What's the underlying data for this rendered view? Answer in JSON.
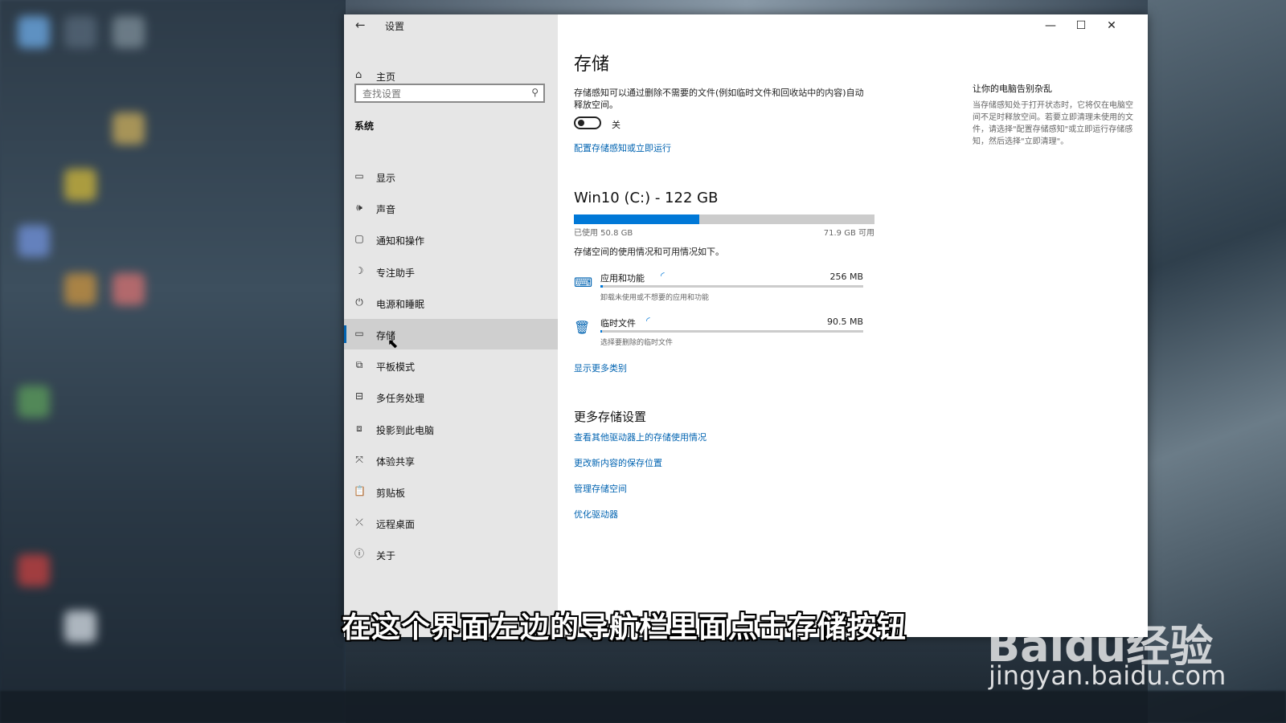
{
  "window": {
    "app_title": "设置",
    "controls": {
      "minimize": "—",
      "maximize": "☐",
      "close": "✕"
    }
  },
  "sidebar": {
    "home": "主页",
    "search_placeholder": "查找设置",
    "section": "系统",
    "items": [
      {
        "label": "显示",
        "icon": "monitor-icon",
        "glyph": "▭"
      },
      {
        "label": "声音",
        "icon": "speaker-icon",
        "glyph": "🕪"
      },
      {
        "label": "通知和操作",
        "icon": "notification-icon",
        "glyph": "▢"
      },
      {
        "label": "专注助手",
        "icon": "moon-icon",
        "glyph": "☽"
      },
      {
        "label": "电源和睡眠",
        "icon": "power-icon",
        "glyph": "⏻"
      },
      {
        "label": "存储",
        "icon": "storage-icon",
        "glyph": "▭"
      },
      {
        "label": "平板模式",
        "icon": "tablet-icon",
        "glyph": "⧉"
      },
      {
        "label": "多任务处理",
        "icon": "multitask-icon",
        "glyph": "⊟"
      },
      {
        "label": "投影到此电脑",
        "icon": "project-icon",
        "glyph": "⧈"
      },
      {
        "label": "体验共享",
        "icon": "share-icon",
        "glyph": "⤧"
      },
      {
        "label": "剪贴板",
        "icon": "clipboard-icon",
        "glyph": "📋"
      },
      {
        "label": "远程桌面",
        "icon": "remote-icon",
        "glyph": "⤫"
      },
      {
        "label": "关于",
        "icon": "info-icon",
        "glyph": "ⓘ"
      }
    ],
    "selected_index": 5
  },
  "main": {
    "title": "存储",
    "description": "存储感知可以通过删除不需要的文件(例如临时文件和回收站中的内容)自动释放空间。",
    "toggle_state": "关",
    "configure_link": "配置存储感知或立即运行",
    "drive": {
      "title": "Win10 (C:) - 122 GB",
      "used_label": "已使用 50.8 GB",
      "free_label": "71.9 GB 可用",
      "used_fraction": 0.416
    },
    "usage_desc": "存储空间的使用情况和可用情况如下。",
    "categories": [
      {
        "name": "应用和功能",
        "size": "256 MB",
        "sub": "卸载未使用或不想要的应用和功能",
        "icon": "apps-icon",
        "fill": 0.01
      },
      {
        "name": "临时文件",
        "size": "90.5 MB",
        "sub": "选择要删除的临时文件",
        "icon": "trash-icon",
        "fill": 0.005
      }
    ],
    "show_more": "显示更多类别",
    "more_title": "更多存储设置",
    "more_links": [
      "查看其他驱动器上的存储使用情况",
      "更改新内容的保存位置",
      "管理存储空间",
      "优化驱动器"
    ]
  },
  "tip": {
    "title": "让你的电脑告别杂乱",
    "text": "当存储感知处于打开状态时，它将仅在电脑空间不足时释放空间。若要立即清理未使用的文件，请选择\"配置存储感知\"或立即运行存储感知，然后选择\"立即清理\"。"
  },
  "overlay": {
    "subtitle": "在这个界面左边的导航栏里面点击存储按钮",
    "watermark_logo": "Baidu经验",
    "watermark_url": "jingyan.baidu.com"
  },
  "colors": {
    "accent": "#0078d7",
    "link": "#0063b1",
    "sidebar_bg": "#e6e6e6",
    "selected_bg": "#cfcfcf"
  }
}
